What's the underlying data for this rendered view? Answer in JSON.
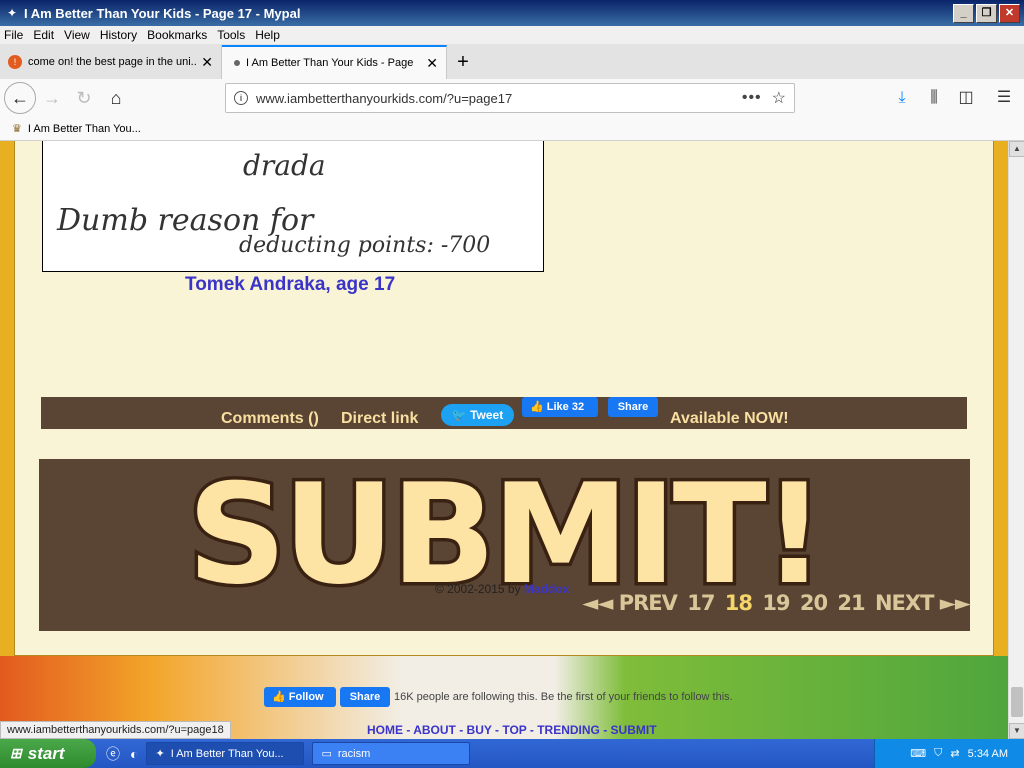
{
  "window": {
    "title": "I Am Better Than Your Kids - Page 17 - Mypal"
  },
  "menu": [
    "File",
    "Edit",
    "View",
    "History",
    "Bookmarks",
    "Tools",
    "Help"
  ],
  "tabs": [
    {
      "label": "come on! the best page in the uni..."
    },
    {
      "label": "I Am Better Than Your Kids - Page"
    }
  ],
  "address": {
    "url": "www.iambetterthanyourkids.com/?u=page17"
  },
  "bookmarks": [
    {
      "label": "I Am Better Than You..."
    }
  ],
  "page": {
    "caption": "Tomek Andraka, age 17",
    "scan_text": {
      "line1": "drada",
      "line2": "Dumb reason for",
      "line3": "deducting points: -700"
    },
    "share": {
      "comments": "Comments ()",
      "direct_link": "Direct link",
      "tweet": "Tweet",
      "like": "Like 32",
      "share": "Share",
      "available": "Available NOW!"
    },
    "banner": {
      "text": "SUBMIT!"
    },
    "pager": {
      "prev": "◄◄ PREV",
      "pages": [
        "17",
        "18",
        "19",
        "20",
        "21"
      ],
      "next": "NEXT ►►",
      "current": "18"
    },
    "follow": {
      "button": "Follow",
      "share": "Share",
      "text": "16K people are following this. Be the first of your friends to follow this."
    },
    "footer_nav": "HOME - ABOUT - BUY - TOP - TRENDING - SUBMIT",
    "copyright": "© 2002-2015 by",
    "copyright_author": "Maddox"
  },
  "status_url": "www.iambetterthanyourkids.com/?u=page18",
  "taskbar": {
    "start": "start",
    "tasks": [
      "I Am Better Than You...",
      "racism"
    ],
    "clock": "5:34 AM"
  }
}
